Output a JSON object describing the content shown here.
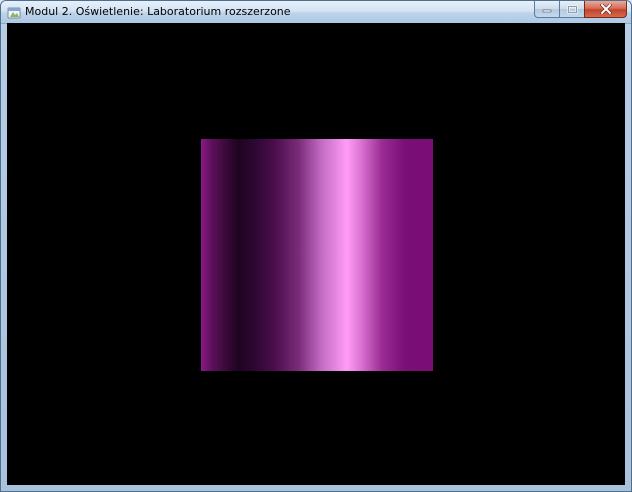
{
  "window": {
    "title": "Modul 2. Oświetlenie: Laboratorium rozszerzone",
    "icon": "app-window-icon",
    "controls": {
      "minimize_icon": "minimize-icon",
      "maximize_icon": "maximize-icon",
      "close_icon": "close-icon"
    }
  },
  "scene": {
    "background_color": "#000000",
    "object": "lit-square",
    "object_colors": {
      "base": "#7a0d76",
      "highlight": "#ff9cf7",
      "shadow": "#1e0420"
    }
  }
}
